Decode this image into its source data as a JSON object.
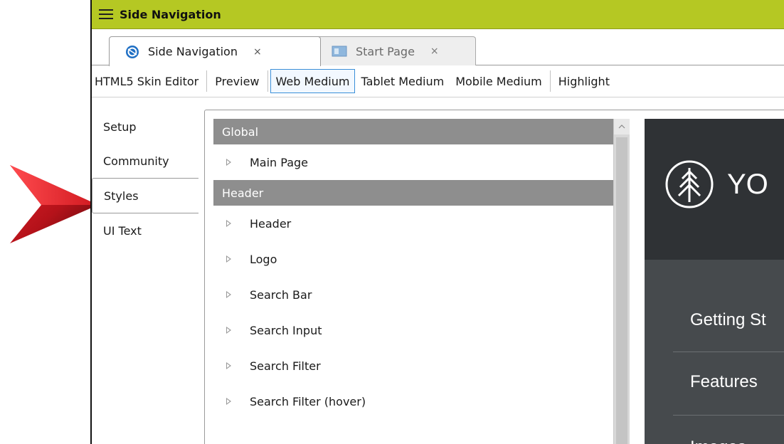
{
  "window": {
    "title": "Side Navigation"
  },
  "tabs": [
    {
      "label": "Side Navigation",
      "close": "×",
      "icon": "globe-icon",
      "active": true
    },
    {
      "label": "Start Page",
      "close": "×",
      "icon": "start-page-icon",
      "active": false
    }
  ],
  "toolbar": {
    "skin_editor": "HTML5 Skin Editor",
    "preview": "Preview",
    "web_medium": "Web Medium",
    "tablet_medium": "Tablet Medium",
    "mobile_medium": "Mobile Medium",
    "highlight": "Highlight"
  },
  "side_tabs": [
    "Setup",
    "Community",
    "Styles",
    "UI Text"
  ],
  "groups": {
    "global": {
      "title": "Global",
      "items": [
        "Main Page"
      ]
    },
    "header": {
      "title": "Header",
      "items": [
        "Header",
        "Logo",
        "Search Bar",
        "Search Input",
        "Search Filter",
        "Search Filter (hover)"
      ]
    }
  },
  "preview": {
    "logo_text": "YO",
    "nav": [
      "Getting St",
      "Features",
      "Images"
    ]
  },
  "colors": {
    "title_bar": "#b5c823",
    "group_header": "#8e8e8e",
    "preview_header": "#2f3235",
    "preview_body": "#464a4d",
    "selected_border": "#3a8fd8",
    "callout_arrow": "#c0141b"
  }
}
